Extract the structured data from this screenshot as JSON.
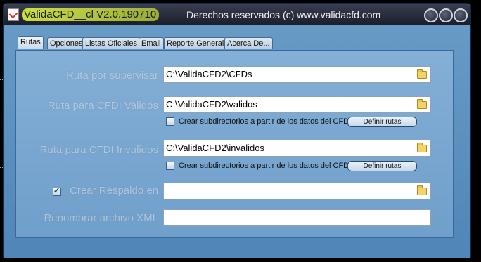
{
  "window": {
    "app_title": "ValidaCFD__cl V2.0.190710",
    "right_title": "Derechos reservados (c) www.validacfd.com"
  },
  "tabs": [
    {
      "label": "Rutas",
      "active": true
    },
    {
      "label": "Opciones",
      "active": false
    },
    {
      "label": "Listas Oficiales",
      "active": false
    },
    {
      "label": "Email",
      "active": false
    },
    {
      "label": "Reporte General",
      "active": false
    },
    {
      "label": "Acerca De...",
      "active": false
    }
  ],
  "form": {
    "supervisar": {
      "label": "Ruta por supervisar",
      "value": "C:\\ValidaCFD2\\CFDs"
    },
    "validos": {
      "label": "Ruta para CFDI Validos",
      "value": "C:\\ValidaCFD2\\validos"
    },
    "validos_opt": {
      "label": "Crear subdirectorios a partir de los datos del CFDI",
      "checked": false,
      "button": "Definir rutas"
    },
    "invalidos": {
      "label": "Ruta para CFDI Invalidos",
      "value": "C:\\ValidaCFD2\\invalidos"
    },
    "invalidos_opt": {
      "label": "Crear subdirectorios a partir de los datos del CFDI",
      "checked": false,
      "button": "Definir rutas"
    },
    "respaldo": {
      "label": "Crear Respaldo en",
      "checked": true,
      "value": ""
    },
    "renombrar": {
      "label": "Renombrar archivo XML",
      "value": ""
    }
  },
  "icons": [
    "checkmark-app-icon",
    "folder-icon"
  ]
}
